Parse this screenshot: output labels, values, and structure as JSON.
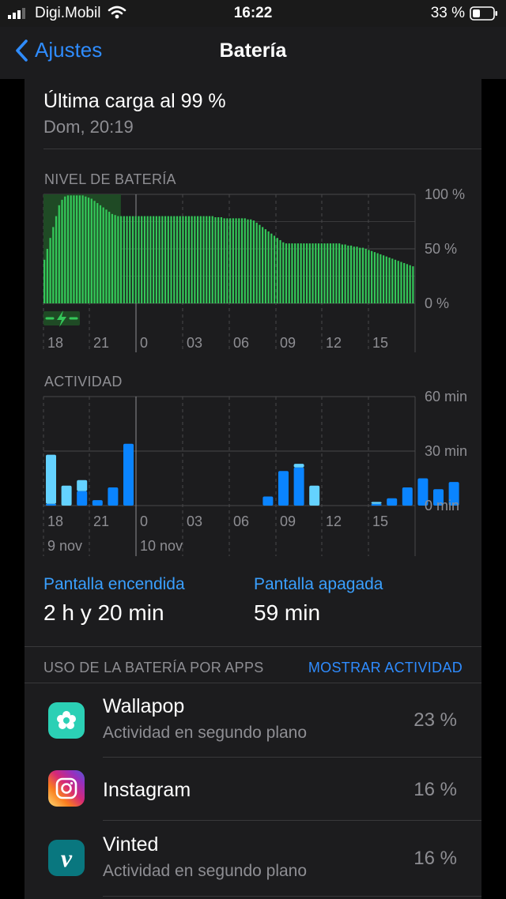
{
  "status": {
    "carrier": "Digi.Mobil",
    "time": "16:22",
    "battery_pct": "33 %"
  },
  "nav": {
    "back_label": "Ajustes",
    "title": "Batería"
  },
  "last_charge": {
    "title": "Última carga al 99 %",
    "time": "Dom, 20:19"
  },
  "battery_level": {
    "section": "NIVEL DE BATERÍA"
  },
  "activity": {
    "section": "ACTIVIDAD"
  },
  "screen": {
    "on_label": "Pantalla encendida",
    "on_value": "2 h y 20 min",
    "off_label": "Pantalla apagada",
    "off_value": "59 min"
  },
  "usage": {
    "section": "USO DE LA BATERÍA POR APPS",
    "show_activity": "MOSTRAR ACTIVIDAD"
  },
  "apps": [
    {
      "name": "Wallapop",
      "sub": "Actividad en segundo plano",
      "pct": "23 %"
    },
    {
      "name": "Instagram",
      "sub": "",
      "pct": "16 %"
    },
    {
      "name": "Vinted",
      "sub": "Actividad en segundo plano",
      "pct": "16 %"
    }
  ],
  "colors": {
    "accent": "#2f8cff",
    "battery_green": "#34c759",
    "screen_on": "#0a84ff",
    "screen_off": "#64d2ff"
  },
  "chart_data": [
    {
      "type": "bar",
      "title": "NIVEL DE BATERÍA",
      "x_tick_labels": [
        "18",
        "21",
        "0",
        "03",
        "06",
        "09",
        "12",
        "15"
      ],
      "y_tick_labels": [
        "100 %",
        "50 %",
        "0 %"
      ],
      "ylim": [
        0,
        100
      ],
      "grid": true,
      "charging_indicator_range": [
        0,
        2
      ],
      "values": [
        40,
        50,
        60,
        70,
        80,
        90,
        95,
        98,
        99,
        99,
        99,
        99,
        99,
        99,
        98,
        97,
        96,
        94,
        92,
        90,
        88,
        86,
        84,
        82,
        81,
        80,
        80,
        80,
        80,
        80,
        80,
        80,
        80,
        80,
        80,
        80,
        80,
        80,
        80,
        80,
        80,
        80,
        80,
        80,
        80,
        80,
        80,
        80,
        80,
        80,
        80,
        80,
        80,
        80,
        80,
        80,
        80,
        80,
        79,
        79,
        79,
        78,
        78,
        78,
        78,
        78,
        78,
        78,
        78,
        77,
        77,
        76,
        74,
        72,
        70,
        68,
        66,
        64,
        62,
        60,
        58,
        56,
        55,
        55,
        55,
        55,
        55,
        55,
        55,
        55,
        55,
        55,
        55,
        55,
        55,
        55,
        55,
        55,
        55,
        55,
        55,
        54,
        54,
        53,
        53,
        52,
        52,
        51,
        51,
        50,
        49,
        48,
        47,
        46,
        45,
        44,
        43,
        42,
        41,
        40,
        39,
        38,
        37,
        36,
        35,
        34
      ]
    },
    {
      "type": "bar",
      "title": "ACTIVIDAD",
      "x_tick_labels": [
        "18",
        "21",
        "0",
        "03",
        "06",
        "09",
        "12",
        "15"
      ],
      "date_labels": [
        "9 nov",
        "10 nov"
      ],
      "y_tick_labels": [
        "60 min",
        "30 min",
        "0 min"
      ],
      "ylim": [
        0,
        60
      ],
      "grid": true,
      "series": [
        {
          "name": "Pantalla encendida",
          "values": [
            1,
            0,
            8,
            3,
            10,
            34,
            0,
            0,
            0,
            0,
            0,
            0,
            0,
            0,
            5,
            19,
            21,
            0,
            0,
            0,
            0,
            1,
            4,
            10,
            15,
            9,
            13,
            0,
            0
          ]
        },
        {
          "name": "Pantalla apagada",
          "values": [
            27,
            11,
            6,
            0,
            0,
            0,
            0,
            0,
            0,
            0,
            0,
            0,
            0,
            0,
            0,
            0,
            2,
            11,
            0,
            0,
            0,
            1,
            0,
            0,
            0,
            0,
            0,
            0,
            0
          ]
        }
      ]
    }
  ]
}
